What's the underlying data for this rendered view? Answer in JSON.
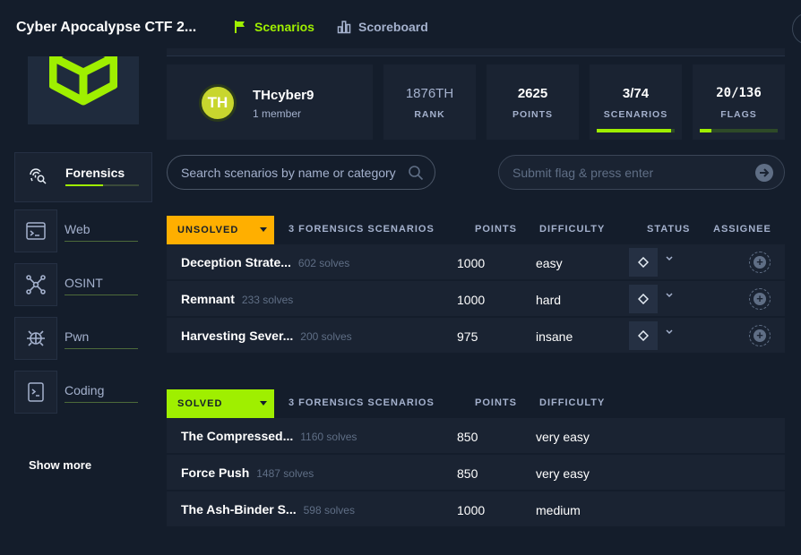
{
  "header": {
    "app_title": "Cyber Apocalypse CTF 2...",
    "nav": [
      {
        "label": "Scenarios",
        "icon": "flag-icon",
        "active": true
      },
      {
        "label": "Scoreboard",
        "icon": "bar-chart-icon",
        "active": false
      }
    ]
  },
  "sidebar": {
    "categories": [
      {
        "label": "Forensics",
        "icon": "fingerprint-search-icon",
        "active": true
      },
      {
        "label": "Web",
        "icon": "terminal-window-icon",
        "active": false
      },
      {
        "label": "OSINT",
        "icon": "network-nodes-icon",
        "active": false
      },
      {
        "label": "Pwn",
        "icon": "bug-icon",
        "active": false
      },
      {
        "label": "Coding",
        "icon": "code-file-icon",
        "active": false
      }
    ],
    "show_more": "Show more"
  },
  "team": {
    "initials": "TH",
    "name": "THcyber9",
    "members": "1 member",
    "stats": {
      "rank": {
        "value": "1876TH",
        "label": "RANK"
      },
      "points": {
        "value": "2625",
        "label": "POINTS"
      },
      "scenarios": {
        "value": "3/74",
        "label": "SCENARIOS",
        "progress": 0.95
      },
      "flags": {
        "value": "20/136",
        "label": "FLAGS",
        "progress": 0.15
      }
    }
  },
  "search": {
    "placeholder": "Search scenarios by name or category"
  },
  "flag_input": {
    "placeholder": "Submit flag & press enter"
  },
  "unsolved": {
    "filter_label": "UNSOLVED",
    "count_label": "3 FORENSICS SCENARIOS",
    "columns": {
      "points": "POINTS",
      "difficulty": "DIFFICULTY",
      "status": "STATUS",
      "assignee": "ASSIGNEE"
    },
    "rows": [
      {
        "name": "Deception Strate...",
        "solves": "602 solves",
        "points": "1000",
        "difficulty": "easy"
      },
      {
        "name": "Remnant",
        "solves": "233 solves",
        "points": "1000",
        "difficulty": "hard"
      },
      {
        "name": "Harvesting Sever...",
        "solves": "200 solves",
        "points": "975",
        "difficulty": "insane"
      }
    ]
  },
  "solved": {
    "filter_label": "SOLVED",
    "count_label": "3 FORENSICS SCENARIOS",
    "columns": {
      "points": "POINTS",
      "difficulty": "DIFFICULTY"
    },
    "rows": [
      {
        "name": "The Compressed...",
        "solves": "1160 solves",
        "points": "850",
        "difficulty": "very easy"
      },
      {
        "name": "Force Push",
        "solves": "1487 solves",
        "points": "850",
        "difficulty": "very easy"
      },
      {
        "name": "The Ash-Binder S...",
        "solves": "598 solves",
        "points": "1000",
        "difficulty": "medium"
      }
    ]
  },
  "colors": {
    "accent_green": "#9fef00",
    "accent_orange": "#ffaf00",
    "background": "#141d2b",
    "panel": "#1a2332"
  }
}
